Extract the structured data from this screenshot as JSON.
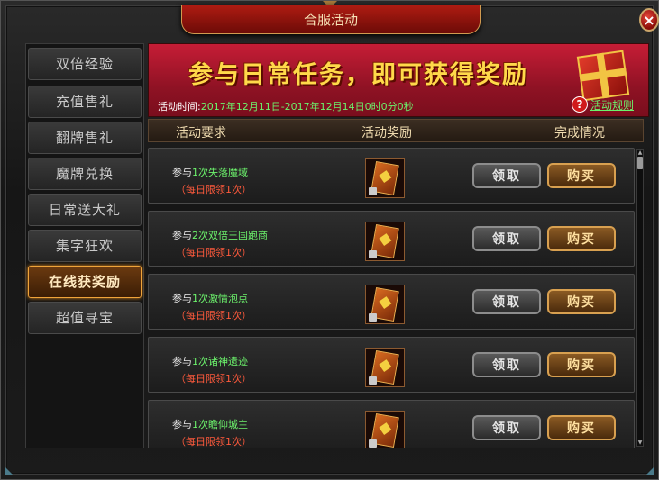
{
  "window": {
    "title": "合服活动",
    "close_label": "×"
  },
  "sidebar": {
    "items": [
      {
        "label": "双倍经验",
        "active": false
      },
      {
        "label": "充值售礼",
        "active": false
      },
      {
        "label": "翻牌售礼",
        "active": false
      },
      {
        "label": "魔牌兑换",
        "active": false
      },
      {
        "label": "日常送大礼",
        "active": false
      },
      {
        "label": "集字狂欢",
        "active": false
      },
      {
        "label": "在线获奖励",
        "active": true
      },
      {
        "label": "超值寻宝",
        "active": false
      }
    ]
  },
  "banner": {
    "headline": "参与日常任务，即可获得奖励",
    "time_label": "活动时间:",
    "time_value": "2017年12月11日-2017年12月14日0时0分0秒",
    "rules_label": "活动规则",
    "help_icon": "?"
  },
  "table": {
    "headers": [
      "活动要求",
      "活动奖励",
      "完成情况"
    ],
    "rows": [
      {
        "prefix": "参与",
        "task": "1次失落魔域",
        "limit": "（每日限领1次）"
      },
      {
        "prefix": "参与",
        "task": "2次双倍王国跑商",
        "limit": "（每日限领1次）"
      },
      {
        "prefix": "参与",
        "task": "1次激情泡点",
        "limit": "（每日限领1次）"
      },
      {
        "prefix": "参与",
        "task": "1次诸神遗迹",
        "limit": "（每日限领1次）"
      },
      {
        "prefix": "参与",
        "task": "1次瞻仰城主",
        "limit": "（每日限领1次）"
      }
    ],
    "claim_label": "领取",
    "buy_label": "购买"
  },
  "colors": {
    "accent_red": "#c61d36",
    "highlight_green": "#6cf26c",
    "limit_red": "#ff5a3c",
    "gold": "#ffd94a"
  },
  "icons": {
    "close": "close-icon",
    "help": "help-icon",
    "reward": "card-reward-icon",
    "lock": "lock-icon"
  }
}
